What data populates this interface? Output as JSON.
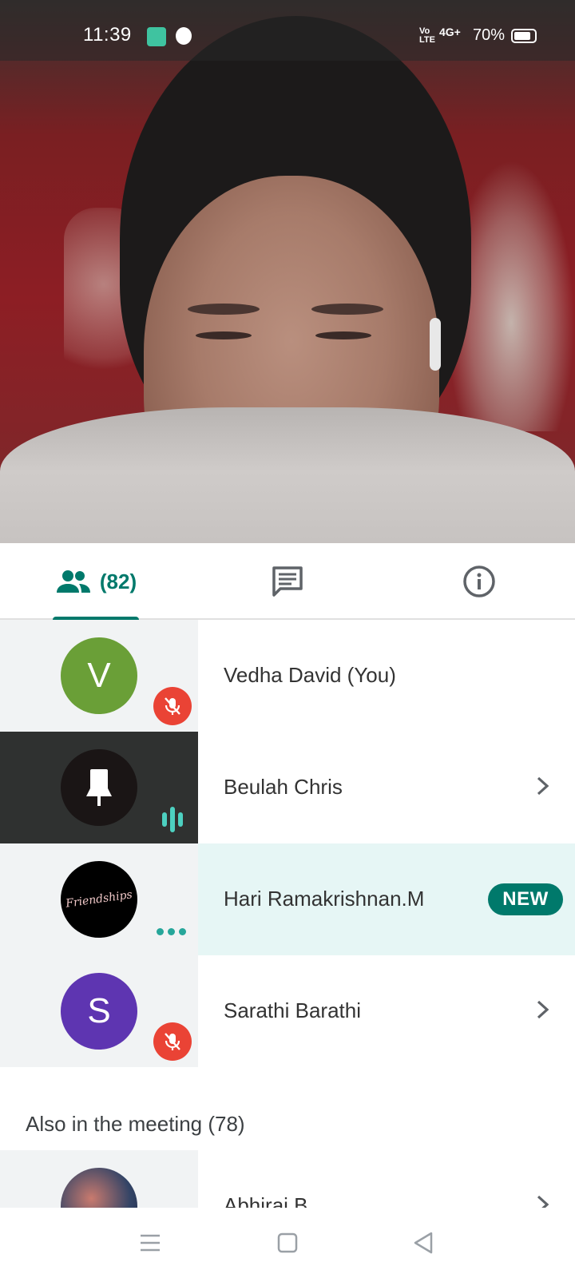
{
  "status_bar": {
    "time": "11:39",
    "volte": "Vo LTE",
    "network": "4G+",
    "battery_percent": "70%"
  },
  "tabs": {
    "people_count": "(82)",
    "people_icon": "people-icon",
    "chat_icon": "chat-icon",
    "info_icon": "info-icon",
    "accent_color": "#00796b"
  },
  "participants": [
    {
      "initial": "V",
      "name": "Vedha David (You)",
      "avatar_color": "#6a9f37",
      "status": "muted"
    },
    {
      "name": "Beulah Chris",
      "status": "speaking",
      "pinned_icon": "pin-icon"
    },
    {
      "name": "Hari Ramakrishnan.M",
      "status": "connecting",
      "badge": "NEW",
      "avatar_text": "Friendships"
    },
    {
      "initial": "S",
      "name": "Sarathi Barathi",
      "avatar_color": "#5e35b1",
      "status": "muted"
    }
  ],
  "also_in_meeting": {
    "title": "Also in the meeting (78)",
    "first_name": "Abhiraj B"
  },
  "nav": {
    "menu_icon": "menu-icon",
    "home_icon": "home-square-icon",
    "back_icon": "back-triangle-icon"
  }
}
